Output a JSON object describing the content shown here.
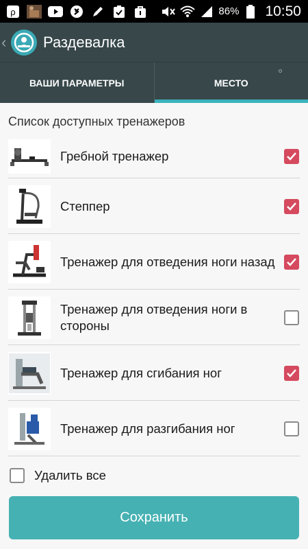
{
  "status_bar": {
    "battery_percent": "86%",
    "time": "10:50",
    "icons": [
      "p-app-icon",
      "photo-thumbnail-icon",
      "youtube-icon",
      "shazam-icon",
      "pencil-icon",
      "clipboard-check-icon",
      "bag-icon",
      "mute-icon",
      "wifi-icon",
      "signal-icon",
      "battery-icon"
    ]
  },
  "app_bar": {
    "title": "Раздевалка",
    "logo_icon": "app-logo-icon"
  },
  "tabs": [
    {
      "label": "ВАШИ ПАРАМЕТРЫ",
      "active": false
    },
    {
      "label": "МЕСТО",
      "active": true
    }
  ],
  "list_header": "Список доступных тренажеров",
  "machines": [
    {
      "label": "Гребной тренажер",
      "checked": true,
      "image": "rowing-machine"
    },
    {
      "label": "Степпер",
      "checked": true,
      "image": "stepper-machine"
    },
    {
      "label": "Тренажер для отведения ноги назад",
      "checked": true,
      "image": "glute-kickback-machine"
    },
    {
      "label": "Тренажер для отведения ноги в стороны",
      "checked": false,
      "image": "hip-abduction-machine"
    },
    {
      "label": "Тренажер для сгибания ног",
      "checked": true,
      "image": "leg-curl-machine"
    },
    {
      "label": "Тренажер для разгибания ног",
      "checked": false,
      "image": "leg-extension-machine"
    }
  ],
  "delete_all": {
    "label": "Удалить все",
    "checked": false
  },
  "save_button": "Сохранить",
  "colors": {
    "app_bar": "#37474a",
    "tab_indicator": "#3bb3bd",
    "checkbox_checked": "#d54a5e",
    "save_button": "#46b1b3"
  }
}
